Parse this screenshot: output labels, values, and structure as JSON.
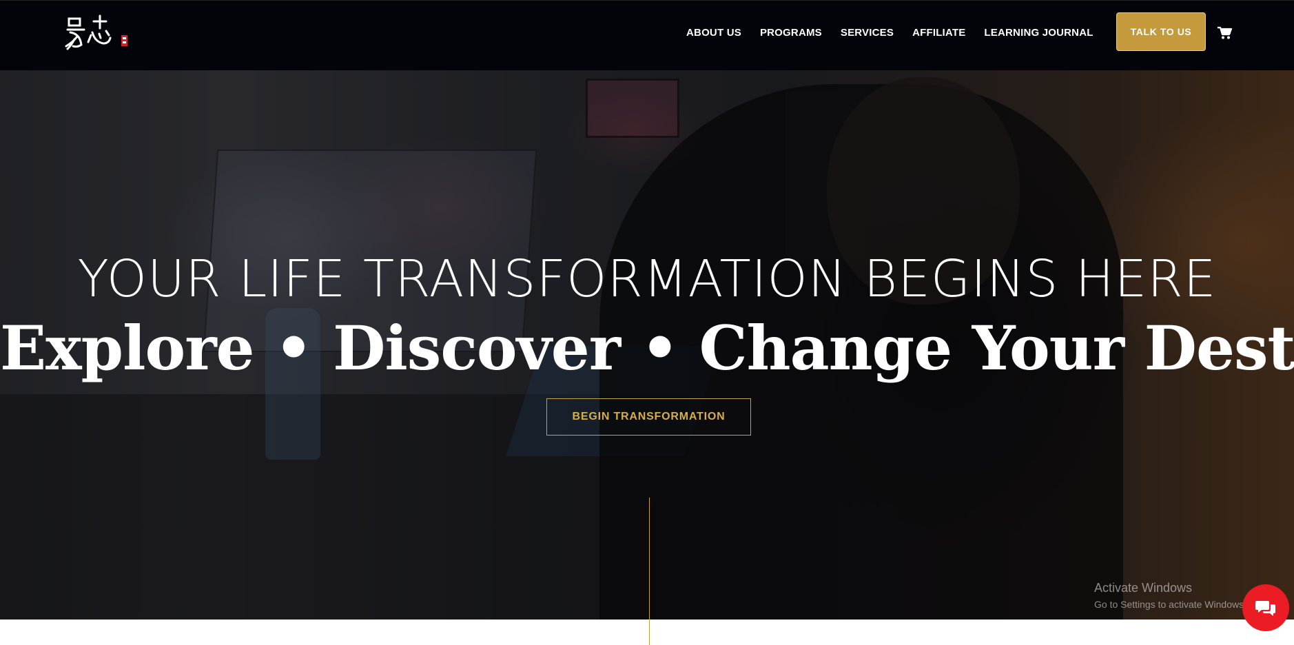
{
  "header": {
    "logo_label": "易志 logo",
    "nav": [
      {
        "label": "ABOUT US"
      },
      {
        "label": "PROGRAMS"
      },
      {
        "label": "SERVICES"
      },
      {
        "label": "AFFILIATE"
      },
      {
        "label": "LEARNING JOURNAL"
      }
    ],
    "cta_label": "TALK TO US",
    "cart_icon": "shopping-cart-icon"
  },
  "hero": {
    "headline": "YOUR LIFE TRANSFORMATION BEGINS HERE",
    "subheadline": "Explore • Discover • Change Your Destiny",
    "cta_label": "BEGIN TRANSFORMATION"
  },
  "overlay": {
    "windows_title": "Activate Windows",
    "windows_sub": "Go to Settings to activate Windows.",
    "chat_icon": "chat-bubbles-icon"
  },
  "colors": {
    "header_bg": "#03040a",
    "accent_gold": "#c49a3c",
    "chat_red": "#ec1c24"
  }
}
